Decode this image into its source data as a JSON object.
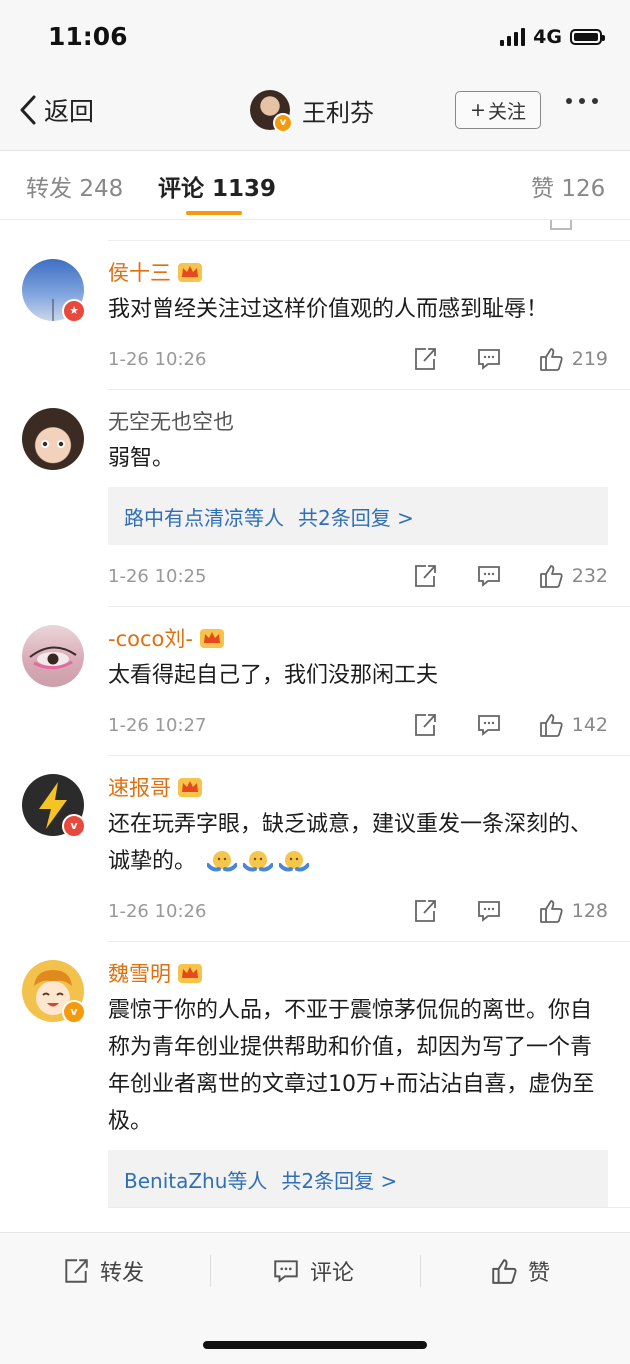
{
  "status": {
    "time": "11:06",
    "network": "4G"
  },
  "nav": {
    "back_label": "返回",
    "user_name": "王利芬",
    "follow_label": "关注",
    "follow_plus": "+"
  },
  "tabs": [
    {
      "label": "转发",
      "count": "248"
    },
    {
      "label": "评论",
      "count": "1139"
    },
    {
      "label": "赞",
      "count": "126"
    }
  ],
  "comments": [
    {
      "name": "侯十三",
      "text": "我对曾经关注过这样价值观的人而感到耻辱！",
      "time": "1-26 10:26",
      "likes": "219",
      "vip": true,
      "avatar_icon": "sky-avatar-icon",
      "badge_icon": "star-badge-icon"
    },
    {
      "name": "无空无也空也",
      "text": "弱智。",
      "time": "1-26 10:25",
      "likes": "232",
      "vip": false,
      "reply_who": "路中有点清凉等人",
      "reply_count": "共2条回复 >",
      "avatar_icon": "child-avatar-icon"
    },
    {
      "name": "-coco刘-",
      "text": "太看得起自己了，我们没那闲工夫",
      "time": "1-26 10:27",
      "likes": "142",
      "vip": true,
      "avatar_icon": "eye-avatar-icon"
    },
    {
      "name": "速报哥",
      "text": "还在玩弄字眼，缺乏诚意，建议重发一条深刻的、诚挚的。",
      "time": "1-26 10:26",
      "likes": "128",
      "vip": true,
      "avatar_icon": "lightning-avatar-icon",
      "badge_icon": "v-badge-icon"
    },
    {
      "name": "魏雪明",
      "text": "震惊于你的人品，不亚于震惊茅侃侃的离世。你自称为青年创业提供帮助和价值，却因为写了一个青年创业者离世的文章过10万+而沾沾自喜，虚伪至极。",
      "time": "",
      "likes": "",
      "vip": true,
      "reply_who": "BenitaZhu等人",
      "reply_count": "共2条回复 >",
      "avatar_icon": "cartoon-avatar-icon",
      "badge_icon": "v-badge-icon"
    }
  ],
  "bottom_bar": {
    "share_label": "转发",
    "comment_label": "评论",
    "like_label": "赞"
  },
  "colors": {
    "accent": "#f59a0c",
    "username": "#e0700f",
    "link": "#2f6fb8",
    "verified_red": "#e8493c"
  }
}
